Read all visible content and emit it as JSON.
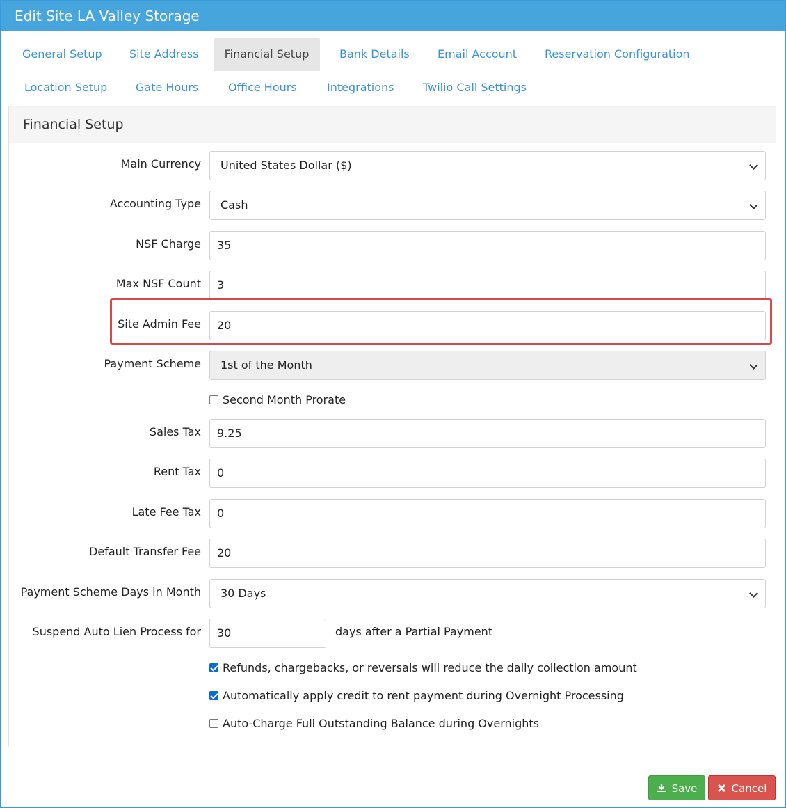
{
  "window": {
    "title": "Edit Site LA Valley Storage"
  },
  "tabs": [
    {
      "label": "General Setup"
    },
    {
      "label": "Site Address"
    },
    {
      "label": "Financial Setup"
    },
    {
      "label": "Bank Details"
    },
    {
      "label": "Email Account"
    },
    {
      "label": "Reservation Configuration"
    },
    {
      "label": "Location Setup"
    },
    {
      "label": "Gate Hours"
    },
    {
      "label": "Office Hours"
    },
    {
      "label": "Integrations"
    },
    {
      "label": "Twilio Call Settings"
    }
  ],
  "active_tab": "Financial Setup",
  "panel": {
    "heading": "Financial Setup"
  },
  "fields": {
    "main_currency": {
      "label": "Main Currency",
      "value": "United States Dollar ($)"
    },
    "accounting_type": {
      "label": "Accounting Type",
      "value": "Cash"
    },
    "nsf_charge": {
      "label": "NSF Charge",
      "value": "35"
    },
    "max_nsf_count": {
      "label": "Max NSF Count",
      "value": "3"
    },
    "site_admin_fee": {
      "label": "Site Admin Fee",
      "value": "20"
    },
    "payment_scheme": {
      "label": "Payment Scheme",
      "value": "1st of the Month"
    },
    "second_month_prorate": {
      "label": "Second Month Prorate",
      "checked": false
    },
    "sales_tax": {
      "label": "Sales Tax",
      "value": "9.25"
    },
    "rent_tax": {
      "label": "Rent Tax",
      "value": "0"
    },
    "late_fee_tax": {
      "label": "Late Fee Tax",
      "value": "0"
    },
    "default_transfer_fee": {
      "label": "Default Transfer Fee",
      "value": "20"
    },
    "payment_scheme_days": {
      "label": "Payment Scheme Days in Month",
      "value": "30 Days"
    },
    "suspend_auto_lien": {
      "label": "Suspend Auto Lien Process for",
      "value": "30",
      "suffix": "days after a Partial Payment"
    }
  },
  "options": [
    {
      "label": "Refunds, chargebacks, or reversals will reduce the daily collection amount",
      "checked": true
    },
    {
      "label": "Automatically apply credit to rent payment during Overnight Processing",
      "checked": true
    },
    {
      "label": "Auto-Charge Full Outstanding Balance during Overnights",
      "checked": false
    }
  ],
  "buttons": {
    "save": {
      "label": "Save",
      "icon": "download-icon"
    },
    "cancel": {
      "label": "Cancel",
      "icon": "close-icon"
    }
  },
  "colors": {
    "title_bar": "#47a5dd",
    "tab_link": "#3a93d8",
    "highlight": "#d94848",
    "save": "#4cae4c",
    "cancel": "#d9534f"
  }
}
